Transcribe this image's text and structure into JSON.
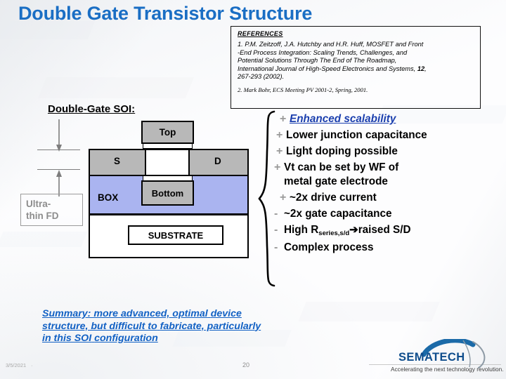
{
  "slide": {
    "title": "Double Gate Transistor Structure",
    "section_heading": "Double-Gate SOI:"
  },
  "references": {
    "heading": "REFERENCES",
    "item1_a": "1. P.M. Zeitzoff, J.A. Hutchby and H.R. Huff, MOSFET and Front",
    "item1_b": "-End Process Integration: Scaling Trends, Challenges, and",
    "item1_c": "Potential Solutions Through The End of The Roadmap,",
    "item1_d": "International Journal of High-Speed Electronics and Systems, ",
    "item1_vol": "12",
    "item1_e": ",",
    "item1_f": "267-293 (2002).",
    "item2": "2. Mark Bohr, ECS Meeting PV 2001-2, Spring, 2001."
  },
  "diagram": {
    "gate_top": "Top",
    "gate_bottom": "Bottom",
    "source": "S",
    "drain": "D",
    "box_layer": "BOX",
    "substrate": "SUBSTRATE",
    "ultrathin_line1": "Ultra-",
    "ultrathin_line2": "thin FD",
    "colors": {
      "box_fill": "#aab4f0",
      "gate_fill": "#b8b8b8",
      "sd_fill": "#b8b8b8",
      "substrate_fill": "#ffffff",
      "outline": "#000000",
      "dim_gray": "#7d7d7d",
      "ultrathin_gray": "#8d8d8d"
    }
  },
  "bullets": [
    {
      "mark": "+",
      "text": "Enhanced scalability",
      "style": "link"
    },
    {
      "mark": "+",
      "text": "Lower junction capacitance",
      "style": "plain"
    },
    {
      "mark": "+",
      "text": "Light doping possible",
      "style": "plain"
    },
    {
      "mark": "+",
      "text": "Vt can be set by WF of",
      "style": "plain"
    },
    {
      "mark": "",
      "text": "metal gate electrode",
      "style": "plain"
    },
    {
      "mark": "+",
      "text": "~2x drive current",
      "style": "plain"
    },
    {
      "mark": "-",
      "text": "~2x gate capacitance",
      "style": "plain"
    },
    {
      "mark": "-",
      "text": "High R",
      "sub": "series,s/d",
      "arrow": "➔",
      "text_after": "raised S/D",
      "style": "sub"
    },
    {
      "mark": "-",
      "text": "Complex process",
      "style": "plain"
    }
  ],
  "summary": {
    "line1": "Summary:  more advanced, optimal",
    "line2": "device structure, but difficult to",
    "line3": "fabricate, particularly in this SOI",
    "line4": "configuration"
  },
  "footer": {
    "date": "3/5/2021",
    "dot": "·",
    "page": "20",
    "logo_name": "SEMATECH",
    "logo_tagline": "Accelerating the next technology revolution."
  },
  "colors": {
    "title_blue": "#1a6ec4",
    "link_blue": "#1b3fae",
    "summary_blue": "#1261c4",
    "logo_blue": "#0f4d8c",
    "bullet_gray": "#9a9a9a"
  }
}
